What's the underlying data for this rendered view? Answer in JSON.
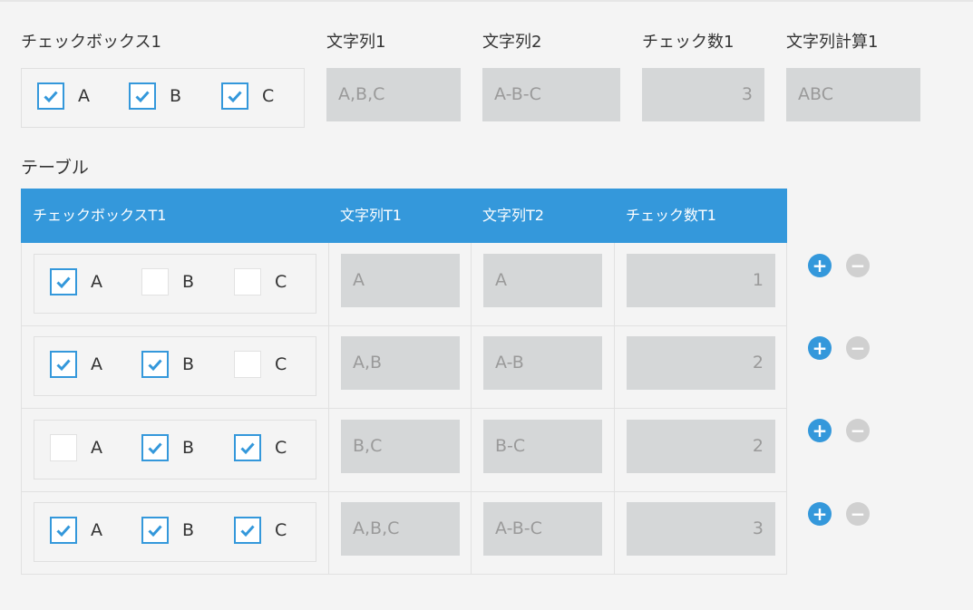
{
  "top": {
    "checkbox_label": "チェックボックス1",
    "options": [
      {
        "label": "A",
        "checked": true
      },
      {
        "label": "B",
        "checked": true
      },
      {
        "label": "C",
        "checked": true
      }
    ],
    "fields": [
      {
        "label": "文字列1",
        "value": "A,B,C"
      },
      {
        "label": "文字列2",
        "value": "A-B-C"
      },
      {
        "label": "チェック数1",
        "value": "3"
      },
      {
        "label": "文字列計算1",
        "value": "ABC"
      }
    ]
  },
  "table": {
    "label": "テーブル",
    "headers": [
      "チェックボックスT1",
      "文字列T1",
      "文字列T2",
      "チェック数T1"
    ],
    "rows": [
      {
        "options": [
          {
            "label": "A",
            "checked": true
          },
          {
            "label": "B",
            "checked": false
          },
          {
            "label": "C",
            "checked": false
          }
        ],
        "str1": "A",
        "str2": "A",
        "count": "1"
      },
      {
        "options": [
          {
            "label": "A",
            "checked": true
          },
          {
            "label": "B",
            "checked": true
          },
          {
            "label": "C",
            "checked": false
          }
        ],
        "str1": "A,B",
        "str2": "A-B",
        "count": "2"
      },
      {
        "options": [
          {
            "label": "A",
            "checked": false
          },
          {
            "label": "B",
            "checked": true
          },
          {
            "label": "C",
            "checked": true
          }
        ],
        "str1": "B,C",
        "str2": "B-C",
        "count": "2"
      },
      {
        "options": [
          {
            "label": "A",
            "checked": true
          },
          {
            "label": "B",
            "checked": true
          },
          {
            "label": "C",
            "checked": true
          }
        ],
        "str1": "A,B,C",
        "str2": "A-B-C",
        "count": "3"
      }
    ],
    "add_icon": "plus-icon",
    "remove_icon": "minus-icon"
  },
  "colors": {
    "accent": "#3498db",
    "field_bg": "#d5d7d8",
    "page_bg": "#f4f4f4"
  }
}
